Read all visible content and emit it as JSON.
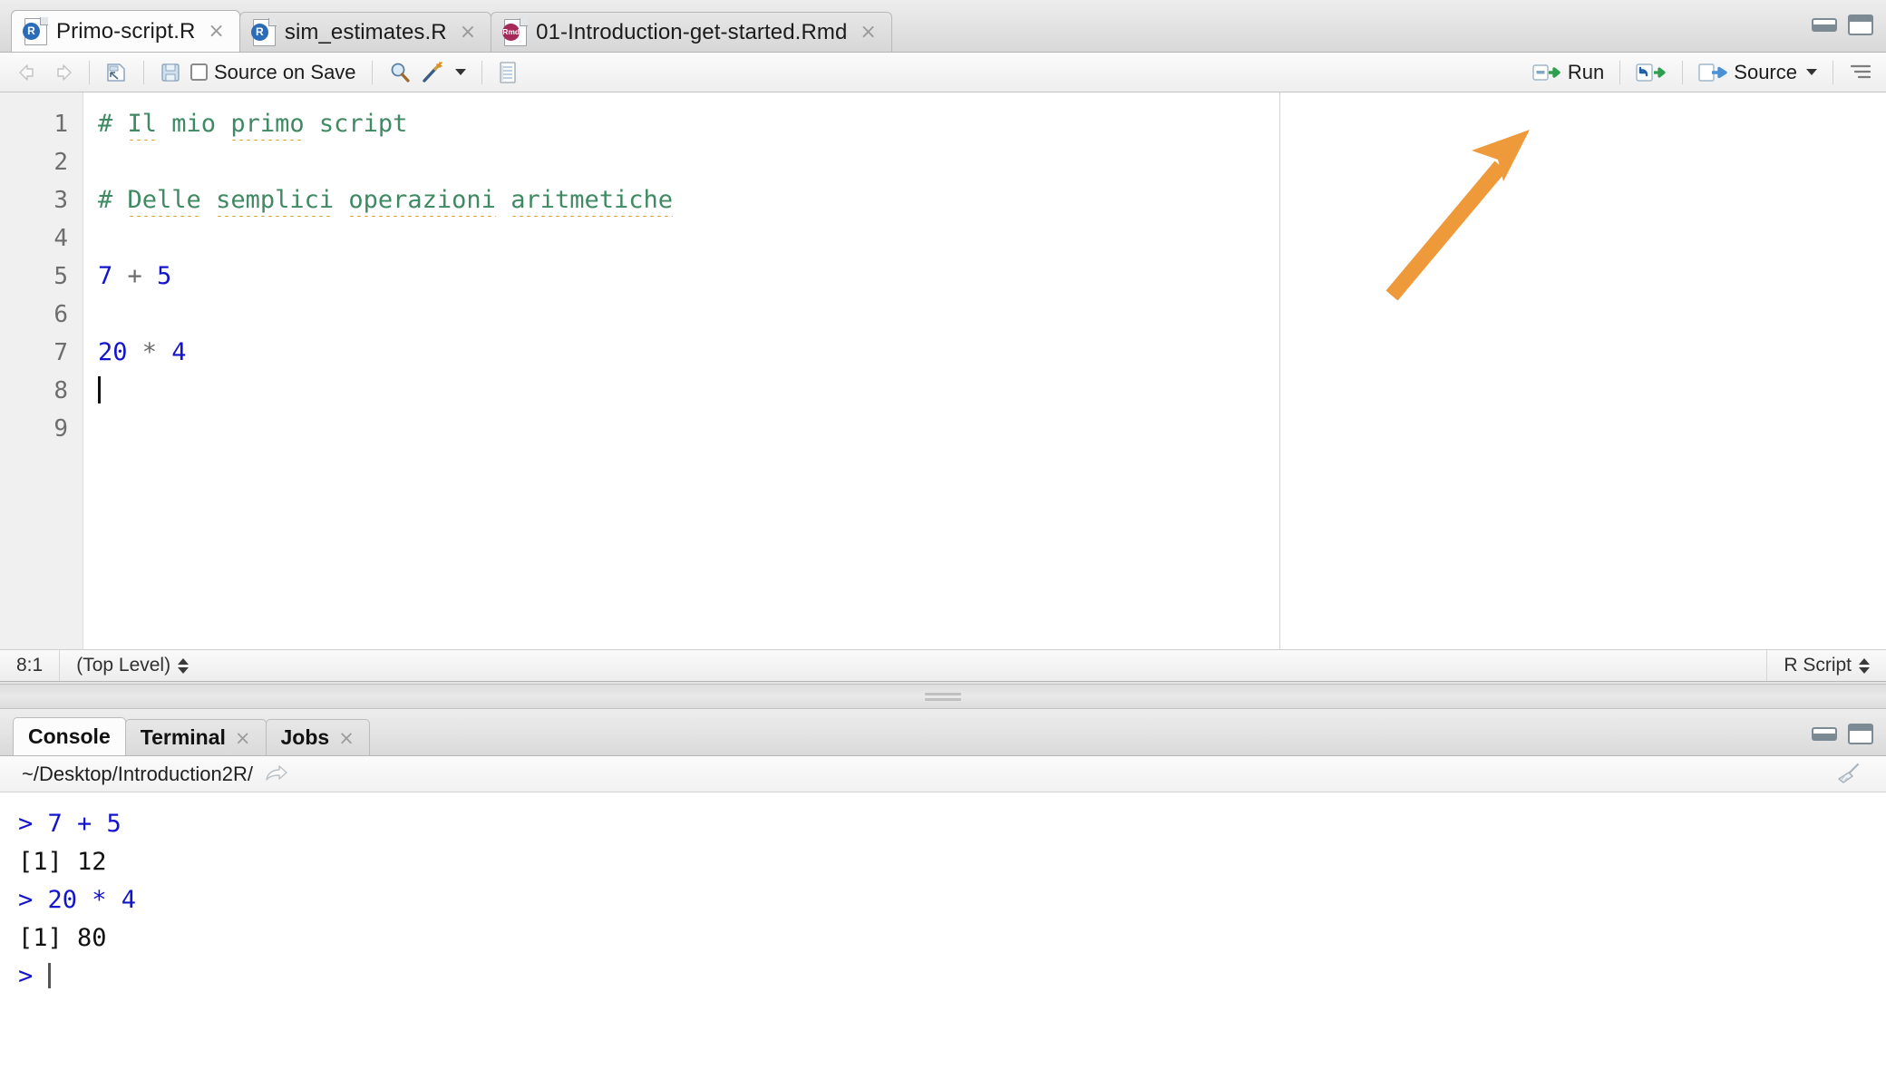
{
  "window": {
    "pane_min_label": "minimize-pane",
    "pane_max_label": "maximize-pane"
  },
  "editor": {
    "tabs": [
      {
        "title": "Primo-script.R",
        "icon": "r-script-icon",
        "badge": "R",
        "close": "×",
        "active": true
      },
      {
        "title": "sim_estimates.R",
        "icon": "r-script-icon",
        "badge": "R",
        "close": "×",
        "active": false
      },
      {
        "title": "01-Introduction-get-started.Rmd",
        "icon": "rmd-file-icon",
        "badge": "Rmd",
        "close": "×",
        "active": false
      }
    ],
    "toolbar": {
      "back_icon": "back-arrow-icon",
      "forward_icon": "forward-arrow-icon",
      "show_in_new_window_icon": "show-in-new-window-icon",
      "save_icon": "save-icon",
      "source_on_save_label": "Source on Save",
      "find_icon": "find-replace-icon",
      "wand_icon": "code-tools-wand-icon",
      "compile_report_icon": "compile-report-icon",
      "run_label": "Run",
      "run_icon": "run-icon",
      "rerun_icon": "rerun-previous-icon",
      "source_label": "Source",
      "source_icon": "source-icon",
      "outline_icon": "document-outline-icon"
    },
    "lines": [
      {
        "n": "1",
        "tokens": [
          {
            "t": "# ",
            "k": "cmt"
          },
          {
            "t": "Il",
            "k": "cmt-spell"
          },
          {
            "t": " mio ",
            "k": "cmt"
          },
          {
            "t": "primo",
            "k": "cmt-spell"
          },
          {
            "t": " script",
            "k": "cmt"
          }
        ]
      },
      {
        "n": "2",
        "tokens": []
      },
      {
        "n": "3",
        "tokens": [
          {
            "t": "# ",
            "k": "cmt"
          },
          {
            "t": "Delle",
            "k": "cmt-spell"
          },
          {
            "t": " ",
            "k": "cmt"
          },
          {
            "t": "semplici",
            "k": "cmt-spell"
          },
          {
            "t": " ",
            "k": "cmt"
          },
          {
            "t": "operazioni",
            "k": "cmt-spell"
          },
          {
            "t": " ",
            "k": "cmt"
          },
          {
            "t": "aritmetiche",
            "k": "cmt-spell"
          }
        ]
      },
      {
        "n": "4",
        "tokens": []
      },
      {
        "n": "5",
        "tokens": [
          {
            "t": "7",
            "k": "num"
          },
          {
            "t": " + ",
            "k": "op"
          },
          {
            "t": "5",
            "k": "num"
          }
        ]
      },
      {
        "n": "6",
        "tokens": []
      },
      {
        "n": "7",
        "tokens": [
          {
            "t": "20",
            "k": "num"
          },
          {
            "t": " * ",
            "k": "op"
          },
          {
            "t": "4",
            "k": "num"
          }
        ]
      },
      {
        "n": "8",
        "tokens": [
          {
            "t": "",
            "k": "caret"
          }
        ]
      },
      {
        "n": "9",
        "tokens": []
      }
    ],
    "statusbar": {
      "cursor_position": "8:1",
      "scope": "(Top Level)",
      "file_type": "R Script"
    },
    "annotation": {
      "type": "arrow",
      "color": "#EF9A3A",
      "points_to": "run-button"
    }
  },
  "console": {
    "tabs": [
      {
        "title": "Console",
        "close": "",
        "active": true
      },
      {
        "title": "Terminal",
        "close": "×",
        "active": false
      },
      {
        "title": "Jobs",
        "close": "×",
        "active": false
      }
    ],
    "working_directory": "~/Desktop/Introduction2R/",
    "open_dir_icon": "open-directory-arrow-icon",
    "clear_icon": "clear-console-broom-icon",
    "output": [
      {
        "kind": "input",
        "prompt": "> ",
        "text": "7 + 5"
      },
      {
        "kind": "result",
        "prompt": "",
        "text": "[1] 12"
      },
      {
        "kind": "input",
        "prompt": "> ",
        "text": "20 * 4"
      },
      {
        "kind": "result",
        "prompt": "",
        "text": "[1] 80"
      },
      {
        "kind": "prompt",
        "prompt": "> ",
        "text": ""
      }
    ]
  },
  "colors": {
    "comment": "#3F8A63",
    "number": "#1414CC",
    "operator": "#6B6B6B",
    "spellcheck_underline": "#D79B2A",
    "annotation_orange": "#EF9A3A",
    "r_badge_blue": "#2B6CB8",
    "rmd_badge_maroon": "#A62A58"
  }
}
